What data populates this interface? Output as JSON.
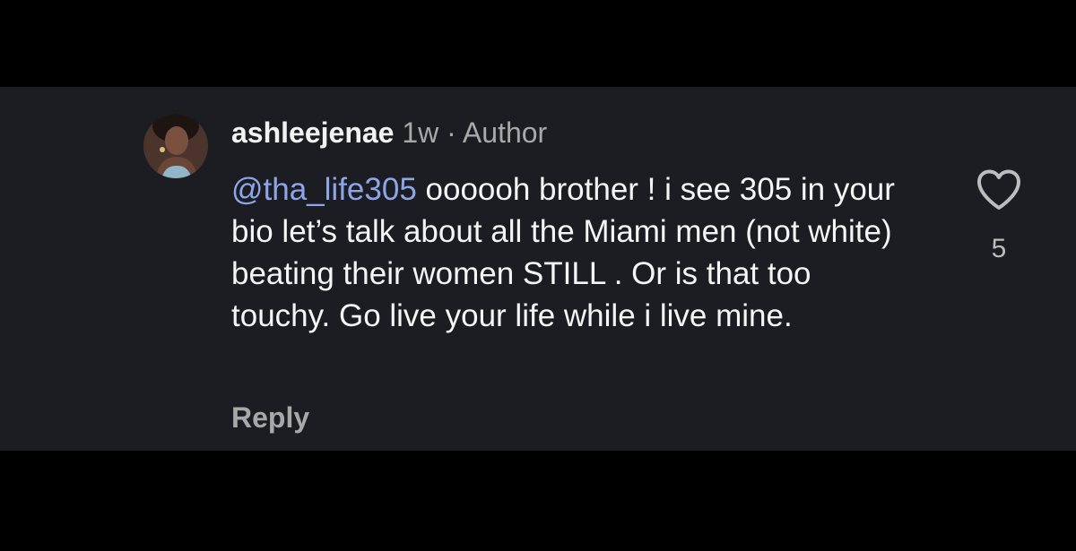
{
  "comment": {
    "username": "ashleejenae",
    "time": "1w",
    "separator": "·",
    "author_label": "Author",
    "mention": "@tha_life305",
    "text_after_mention": " oooooh brother ! i see 305 in your bio let’s talk about all the Miami men (not white) beating their women STILL . Or is that too touchy. Go live your life while i live mine.",
    "reply_label": "Reply",
    "like_count": "5"
  },
  "icons": {
    "like": "heart-outline-icon",
    "avatar": "user-avatar-photo"
  },
  "colors": {
    "background": "#000000",
    "card": "#1c1d22",
    "mention": "#8ea6e8",
    "secondary_text": "#a8a8a8",
    "primary_text": "#f5f5f5"
  }
}
